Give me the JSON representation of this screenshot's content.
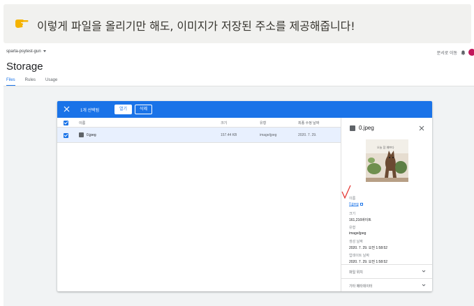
{
  "callout": {
    "text": "이렇게 파일을 올리기만 해도, 이미지가 저장된 주소를 제공해줍니다!",
    "icon": "pointing-hand-icon",
    "hand_color": "#f5b300"
  },
  "header": {
    "project": "sparta-psytest-gun",
    "goto_docs": "문서로 이동",
    "title": "Storage",
    "tabs": [
      {
        "label": "Files",
        "active": true
      },
      {
        "label": "Rules",
        "active": false
      },
      {
        "label": "Usage",
        "active": false
      }
    ]
  },
  "toolbar": {
    "selected_count": "1개 선택됨",
    "open_label": "열기",
    "delete_label": "삭제"
  },
  "table": {
    "columns": [
      "이름",
      "크기",
      "유형",
      "최종 수정 날짜"
    ],
    "rows": [
      {
        "name": "0.jpeg",
        "size": "157.44 KB",
        "type": "image/jpeg",
        "modified": "2020. 7. 29."
      }
    ]
  },
  "details": {
    "file_name": "0.jpeg",
    "name_label": "이름",
    "name_value": "0.jpeg",
    "size_label": "크기",
    "size_value": "161,216바이트",
    "type_label": "유형",
    "type_value": "image/jpeg",
    "created_label": "생성 날짜",
    "created_value": "2020. 7. 29. 오전 1:58:52",
    "updated_label": "업데이트 날짜",
    "updated_value": "2020. 7. 29. 오전 1:58:52",
    "accordion": [
      "파일 위치",
      "기타 메타데이터"
    ]
  },
  "colors": {
    "accent": "#1a73e8",
    "annotation": "#e53935"
  }
}
